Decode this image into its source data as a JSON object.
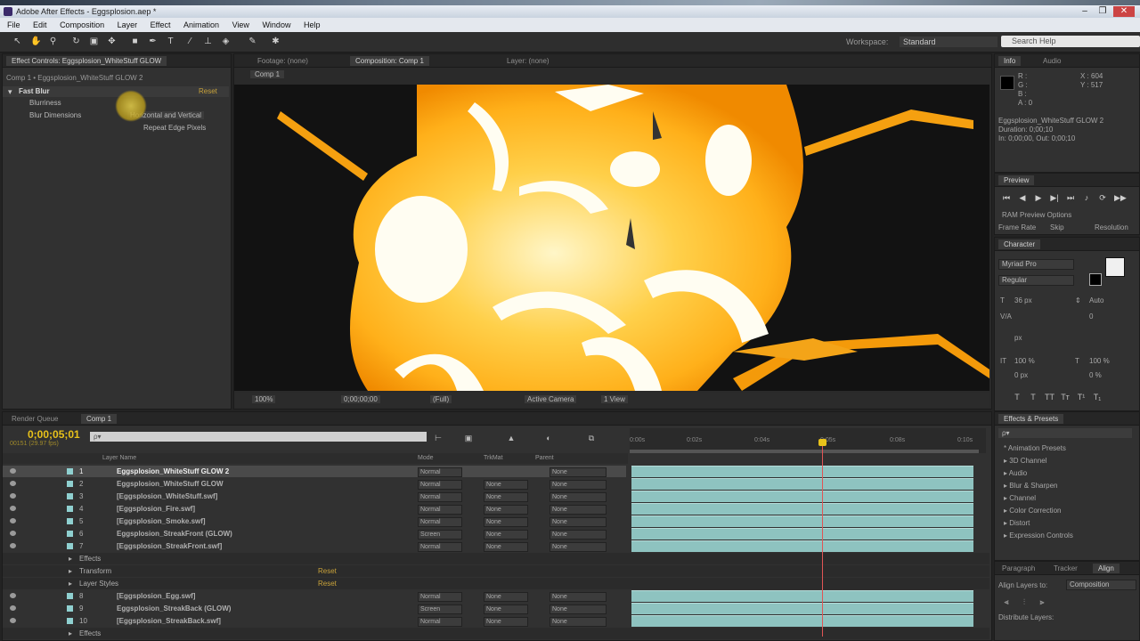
{
  "window": {
    "title": "Adobe After Effects - Eggsplosion.aep *",
    "min": "–",
    "max": "❐",
    "close": "✕"
  },
  "menu": [
    "File",
    "Edit",
    "Composition",
    "Layer",
    "Effect",
    "Animation",
    "View",
    "Window",
    "Help"
  ],
  "toolbar": {
    "workspace_label": "Workspace:",
    "workspace_value": "Standard",
    "search_placeholder": "Search Help"
  },
  "effects_panel": {
    "tab": "Effect Controls: Eggsplosion_WhiteStuff GLOW",
    "breadcrumb": "Comp 1 • Eggsplosion_WhiteStuff GLOW 2",
    "effect_name": "Fast Blur",
    "reset": "Reset",
    "param_blurriness": "Blurriness",
    "param_blur_dimensions": "Blur Dimensions",
    "blur_dim_value": "Horizontal and Vertical",
    "repeat_edge": "Repeat Edge Pixels"
  },
  "comp_panel": {
    "tab_footage": "Footage: (none)",
    "tab_comp": "Composition: Comp 1",
    "tab_layer": "Layer: (none)",
    "comp_label": "Comp 1",
    "zoom": "100%",
    "resolution": "(Full)",
    "camera": "Active Camera",
    "views": "1 View",
    "timecode": "0;00;00;00"
  },
  "info_panel": {
    "tab_info": "Info",
    "tab_audio": "Audio",
    "rgb": [
      "R :",
      "G :",
      "B :",
      "A : 0"
    ],
    "xy": [
      "X : 604",
      "Y : 517"
    ],
    "details": [
      "Eggsplosion_WhiteStuff GLOW 2",
      "Duration: 0;00;10",
      "In: 0;00;00, Out: 0;00;10"
    ]
  },
  "preview_panel": {
    "tab": "Preview",
    "ram_preview": "RAM Preview Options",
    "frame_rate": "Frame Rate",
    "skip": "Skip",
    "resolution": "Resolution"
  },
  "character_panel": {
    "tab": "Character",
    "font": "Myriad Pro",
    "style": "Regular",
    "size": "36 px",
    "leading": "Auto",
    "tracking": "0",
    "stroke": "px",
    "v_scale": "100 %",
    "h_scale": "100 %",
    "baseline": "0 px",
    "tsume": "0 %"
  },
  "timeline": {
    "tab_render": "Render Queue",
    "tab_comp": "Comp 1",
    "timecode": "0;00;05;01",
    "timecode_sub": "00151 (29.97 fps)",
    "search_placeholder": "ρ▾",
    "col_layer_name": "Layer Name",
    "col_mode": "Mode",
    "col_trkmat": "TrkMat",
    "col_parent": "Parent",
    "ruler": [
      "0:00s",
      "0:02s",
      "0:04s",
      "0:05s",
      "0:08s",
      "0:10s"
    ],
    "playhead_fraction": 0.55,
    "layers": [
      {
        "num": "1",
        "name": "Eggsplosion_WhiteStuff GLOW 2",
        "mode": "Normal",
        "trk": "",
        "parent": "None",
        "selected": true
      },
      {
        "num": "2",
        "name": "Eggsplosion_WhiteStuff GLOW",
        "mode": "Normal",
        "trk": "None",
        "parent": "None",
        "selected": false
      },
      {
        "num": "3",
        "name": "[Eggsplosion_WhiteStuff.swf]",
        "mode": "Normal",
        "trk": "None",
        "parent": "None",
        "selected": false
      },
      {
        "num": "4",
        "name": "[Eggsplosion_Fire.swf]",
        "mode": "Normal",
        "trk": "None",
        "parent": "None",
        "selected": false
      },
      {
        "num": "5",
        "name": "[Eggsplosion_Smoke.swf]",
        "mode": "Normal",
        "trk": "None",
        "parent": "None",
        "selected": false
      },
      {
        "num": "6",
        "name": "Eggsplosion_StreakFront (GLOW)",
        "mode": "Screen",
        "trk": "None",
        "parent": "None",
        "selected": false
      },
      {
        "num": "7",
        "name": "[Eggsplosion_StreakFront.swf]",
        "mode": "Normal",
        "trk": "None",
        "parent": "None",
        "selected": false
      }
    ],
    "sub_effects": "Effects",
    "sub_transform": "Transform",
    "sub_transform_val": "Reset",
    "sub_layer_styles": "Layer Styles",
    "sub_layer_styles_val": "Reset",
    "layers2": [
      {
        "num": "8",
        "name": "[Eggsplosion_Egg.swf]",
        "mode": "Normal",
        "trk": "None",
        "parent": "None"
      },
      {
        "num": "9",
        "name": "Eggsplosion_StreakBack (GLOW)",
        "mode": "Screen",
        "trk": "None",
        "parent": "None"
      },
      {
        "num": "10",
        "name": "[Eggsplosion_StreakBack.swf]",
        "mode": "Normal",
        "trk": "None",
        "parent": "None"
      }
    ],
    "sub_effects2": "Effects"
  },
  "effects_presets": {
    "tab": "Effects & Presets",
    "search": "ρ▾",
    "items": [
      "* Animation Presets",
      "▸ 3D Channel",
      "▸ Audio",
      "▸ Blur & Sharpen",
      "▸ Channel",
      "▸ Color Correction",
      "▸ Distort",
      "▸ Expression Controls"
    ]
  },
  "align_panel": {
    "tab_paragraph": "Paragraph",
    "tab_tracker": "Tracker",
    "tab_align": "Align",
    "align_to_label": "Align Layers to:",
    "align_to_value": "Composition",
    "distribute": "Distribute Layers:"
  },
  "colors": {
    "accent": "#e8c21a",
    "clip": "#8ec3c0",
    "playhead": "#e05555"
  }
}
